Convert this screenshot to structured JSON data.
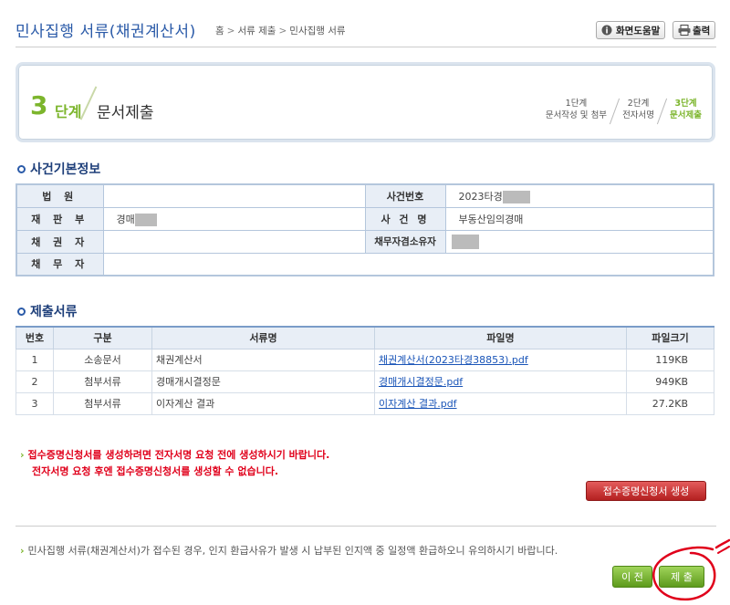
{
  "header": {
    "title": "민사집행 서류(채권계산서)",
    "breadcrumb": [
      "홈",
      "서류 제출",
      "민사집행 서류"
    ],
    "help_label": "화면도움말",
    "print_label": "출력"
  },
  "step": {
    "number": "3",
    "word": "단계",
    "name": "문서제출",
    "steps": [
      {
        "line1": "1단계",
        "line2": "문서작성 및 첨부",
        "active": false
      },
      {
        "line1": "2단계",
        "line2": "전자서명",
        "active": false
      },
      {
        "line1": "3단계",
        "line2": "문서제출",
        "active": true
      }
    ]
  },
  "case_info": {
    "section_title": "사건기본정보",
    "court_label": "법 원",
    "court_value": "",
    "case_no_label": "사건번호",
    "case_no_value": "2023타경",
    "division_label": "재 판 부",
    "division_value": "경매",
    "case_name_label": "사 건 명",
    "case_name_value": "부동산임의경매",
    "creditor_label": "채 권 자",
    "creditor_value": "",
    "debtor_owner_label": "채무자겸소유자",
    "debtor_owner_value": "",
    "debtor_label": "채 무 자",
    "debtor_value": ""
  },
  "documents": {
    "section_title": "제출서류",
    "columns": [
      "번호",
      "구분",
      "서류명",
      "파일명",
      "파일크기"
    ],
    "rows": [
      {
        "no": "1",
        "type": "소송문서",
        "name": "채권계산서",
        "file": "채권계산서(2023타경38853).pdf",
        "size": "119KB"
      },
      {
        "no": "2",
        "type": "첨부서류",
        "name": "경매개시결정문",
        "file": "경매개시결정문.pdf",
        "size": "949KB"
      },
      {
        "no": "3",
        "type": "첨부서류",
        "name": "이자계산 결과",
        "file": "이자계산 결과.pdf",
        "size": "27.2KB"
      }
    ]
  },
  "warning": {
    "line1": "접수증명신청서를 생성하려면 전자서명 요청 전에 생성하시기 바랍니다.",
    "line2": "전자서명 요청 후엔 접수증명신청서를 생성할 수 없습니다."
  },
  "generate_button": "접수증명신청서 생성",
  "note": "민사집행 서류(채권계산서)가 접수된 경우, 인지 환급사유가 발생 시 납부된 인지액 중 일정액 환급하오니 유의하시기 바랍니다.",
  "buttons": {
    "prev": "이 전",
    "submit": "제 출"
  },
  "colors": {
    "title_blue": "#2a5aa8",
    "step_green": "#7cb52c",
    "warning_red": "#e0001b",
    "annotation_red": "#e0001b"
  },
  "icons": [
    "help-icon",
    "printer-icon",
    "arrow-bullet-icon"
  ]
}
